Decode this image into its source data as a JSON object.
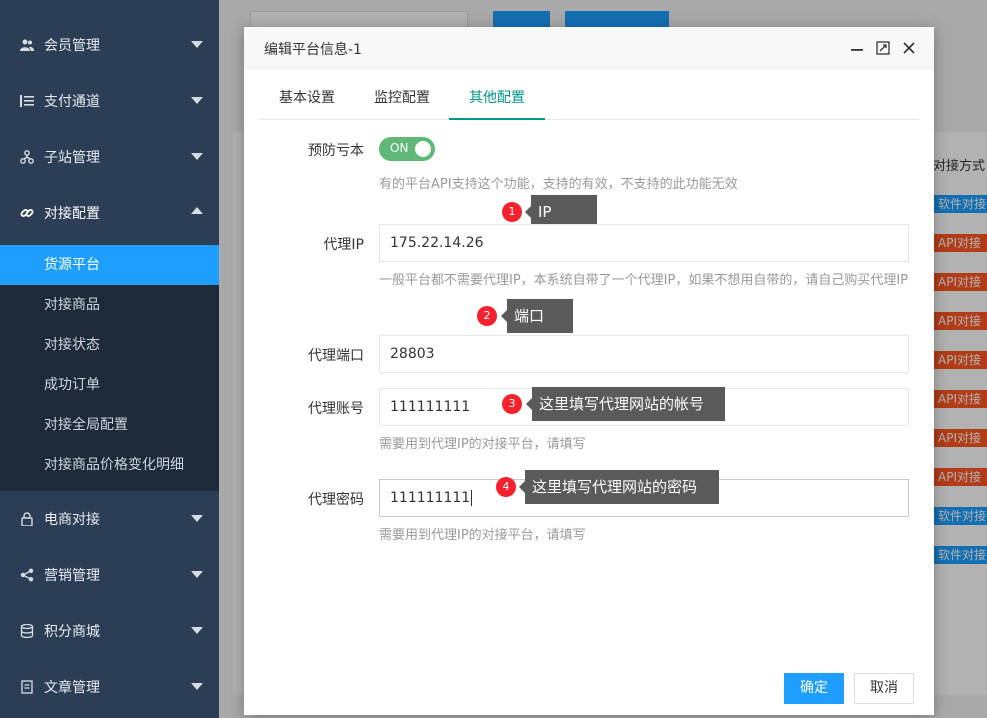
{
  "sidebar": {
    "groups": [
      {
        "label": "会员管理",
        "icon": "users-icon"
      },
      {
        "label": "支付通道",
        "icon": "list-icon"
      },
      {
        "label": "子站管理",
        "icon": "sitemap-icon"
      },
      {
        "label": "对接配置",
        "icon": "link-icon"
      },
      {
        "label": "电商对接",
        "icon": "lock-icon"
      },
      {
        "label": "营销管理",
        "icon": "share-icon"
      },
      {
        "label": "积分商城",
        "icon": "database-icon"
      },
      {
        "label": "文章管理",
        "icon": "file-icon"
      }
    ],
    "active_group": "对接配置",
    "sub_items": [
      "货源平台",
      "对接商品",
      "对接状态",
      "成功订单",
      "对接全局配置",
      "对接商品价格变化明细"
    ],
    "active_sub_item": "货源平台"
  },
  "background": {
    "column_header": "对接方式",
    "tags": [
      "软件对接",
      "API对接",
      "API对接",
      "API对接",
      "API对接",
      "API对接",
      "API对接",
      "API对接",
      "软件对接",
      "软件对接"
    ]
  },
  "modal": {
    "title": "编辑平台信息-1",
    "tabs": [
      "基本设置",
      "监控配置",
      "其他配置"
    ],
    "active_tab": "其他配置",
    "fields": {
      "prevent_loss": {
        "label": "预防亏本",
        "toggle_text": "ON",
        "toggle_on": true,
        "help": "有的平台API支持这个功能，支持的有效，不支持的此功能无效"
      },
      "proxy_ip": {
        "label": "代理IP",
        "value": "175.22.14.26",
        "help": "一般平台都不需要代理IP，本系统自带了一个代理IP，如果不想用自带的，请自己购买代理IP"
      },
      "proxy_port": {
        "label": "代理端口",
        "value": "28803"
      },
      "proxy_account": {
        "label": "代理账号",
        "value": "111111111",
        "help": "需要用到代理IP的对接平台，请填写"
      },
      "proxy_password": {
        "label": "代理密码",
        "value": "111111111",
        "help": "需要用到代理IP的对接平台，请填写"
      }
    },
    "callouts": [
      {
        "num": "1",
        "text": "IP"
      },
      {
        "num": "2",
        "text": "端口"
      },
      {
        "num": "3",
        "text": "这里填写代理网站的帐号"
      },
      {
        "num": "4",
        "text": "这里填写代理网站的密码"
      }
    ],
    "buttons": {
      "ok": "确定",
      "cancel": "取消"
    }
  },
  "colors": {
    "sidebar": "#2c3e55",
    "accent": "#1e9fff",
    "tab_active": "#009688",
    "toggle_on": "#5fb878",
    "badge": "#f5222d",
    "tag_api": "#ff5722"
  }
}
